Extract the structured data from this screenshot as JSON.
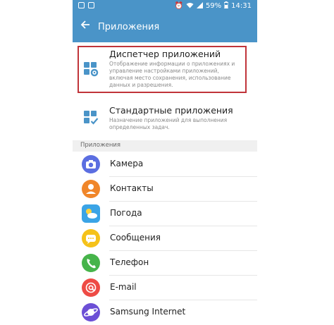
{
  "status_bar": {
    "battery": "59%",
    "time": "14:31"
  },
  "app_bar": {
    "back_icon": "arrow-left-icon",
    "title": "Приложения"
  },
  "settings": [
    {
      "title": "Диспетчер приложений",
      "description": "Отображение информации о приложениях и управление настройками приложений, включая место сохранения, использование данных и разрешения.",
      "icon": "app-manager-icon"
    },
    {
      "title": "Стандартные приложения",
      "description": "Назначение приложений для выполнения определенных задач.",
      "icon": "default-apps-icon"
    }
  ],
  "section_header": "Приложения",
  "apps": [
    {
      "label": "Камера",
      "icon": "camera-icon",
      "color": "#5b6ee1"
    },
    {
      "label": "Контакты",
      "icon": "contacts-icon",
      "color": "#f0862a"
    },
    {
      "label": "Погода",
      "icon": "weather-icon",
      "color": "#3ba4e6"
    },
    {
      "label": "Сообщения",
      "icon": "messages-icon",
      "color": "#f5c21a"
    },
    {
      "label": "Телефон",
      "icon": "phone-icon",
      "color": "#46b44a"
    },
    {
      "label": "E-mail",
      "icon": "email-icon",
      "color": "#ee4b45"
    },
    {
      "label": "Samsung Internet",
      "icon": "samsung-internet-icon",
      "color": "#6c4fd6"
    }
  ],
  "colors": {
    "accent": "#4a94c8",
    "highlight": "#c0343a"
  }
}
